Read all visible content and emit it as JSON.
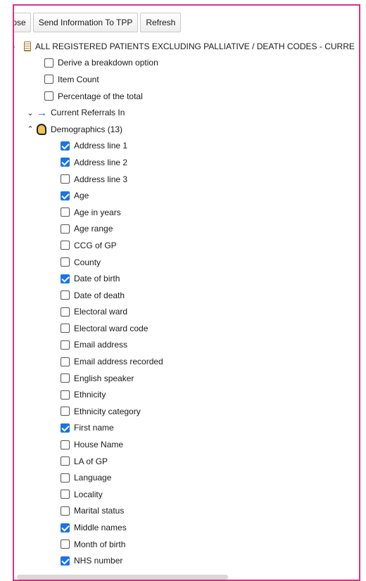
{
  "toolbar": {
    "close_label": "Close",
    "send_label": "Send Information To TPP",
    "refresh_label": "Refresh"
  },
  "tree": {
    "root_label": "ALL REGISTERED PATIENTS EXCLUDING PALLIATIVE / DEATH CODES - CURRE",
    "options": [
      {
        "label": "Derive a breakdown option",
        "checked": false
      },
      {
        "label": "Item Count",
        "checked": false
      },
      {
        "label": "Percentage of the total",
        "checked": false
      }
    ],
    "current_referrals_label": "Current Referrals In",
    "demographics_label": "Demographics (13)",
    "demographics_items": [
      {
        "label": "Address line 1",
        "checked": true
      },
      {
        "label": "Address line 2",
        "checked": true
      },
      {
        "label": "Address line 3",
        "checked": false
      },
      {
        "label": "Age",
        "checked": true
      },
      {
        "label": "Age in years",
        "checked": false
      },
      {
        "label": "Age range",
        "checked": false
      },
      {
        "label": "CCG of GP",
        "checked": false
      },
      {
        "label": "County",
        "checked": false
      },
      {
        "label": "Date of birth",
        "checked": true
      },
      {
        "label": "Date of death",
        "checked": false
      },
      {
        "label": "Electoral ward",
        "checked": false
      },
      {
        "label": "Electoral ward code",
        "checked": false
      },
      {
        "label": "Email address",
        "checked": false
      },
      {
        "label": "Email address recorded",
        "checked": false
      },
      {
        "label": "English speaker",
        "checked": false
      },
      {
        "label": "Ethnicity",
        "checked": false
      },
      {
        "label": "Ethnicity category",
        "checked": false
      },
      {
        "label": "First name",
        "checked": true
      },
      {
        "label": "House Name",
        "checked": false
      },
      {
        "label": "LA of GP",
        "checked": false
      },
      {
        "label": "Language",
        "checked": false
      },
      {
        "label": "Locality",
        "checked": false
      },
      {
        "label": "Marital status",
        "checked": false
      },
      {
        "label": "Middle names",
        "checked": true
      },
      {
        "label": "Month of birth",
        "checked": false
      },
      {
        "label": "NHS number",
        "checked": true
      }
    ]
  },
  "colors": {
    "frame_border": "#d63384",
    "checkbox_checked": "#1a73e8",
    "arrow": "#1a62c9"
  }
}
